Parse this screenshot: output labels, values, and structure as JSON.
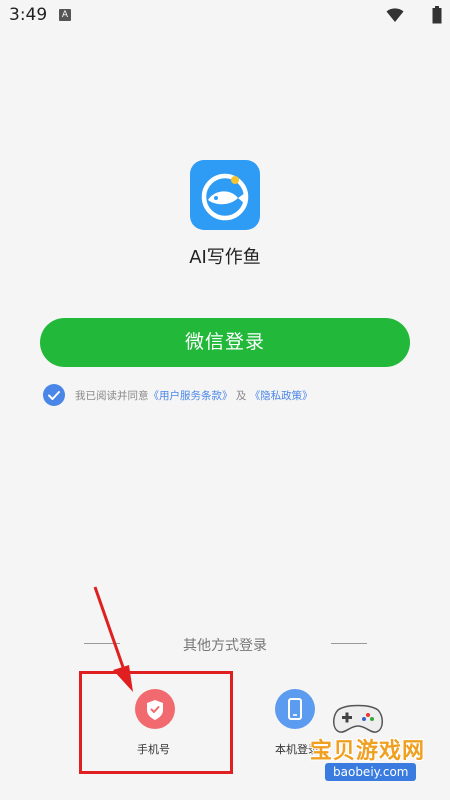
{
  "status_bar": {
    "time": "3:49",
    "notification_icon": "a-letter-icon",
    "wifi_icon": "wifi-icon",
    "battery_icon": "battery-icon"
  },
  "app": {
    "name": "AI写作鱼",
    "logo_icon": "fish-logo-icon"
  },
  "wechat_login": {
    "label": "微信登录",
    "color": "#22b83a"
  },
  "agreement": {
    "checked": true,
    "prefix": "我已阅读并同意",
    "terms_link": "《用户服务条款》",
    "connector": "及",
    "privacy_link": "《隐私政策》"
  },
  "other_login": {
    "title": "其他方式登录",
    "options": [
      {
        "label": "手机号",
        "icon": "shield-check-icon",
        "color": "#f06a6f"
      },
      {
        "label": "本机登录",
        "icon": "phone-device-icon",
        "color": "#5b9bf0"
      }
    ]
  },
  "annotation": {
    "color": "#e02020"
  },
  "watermark": {
    "title": "宝贝游戏网",
    "url": "baobeiy.com"
  }
}
